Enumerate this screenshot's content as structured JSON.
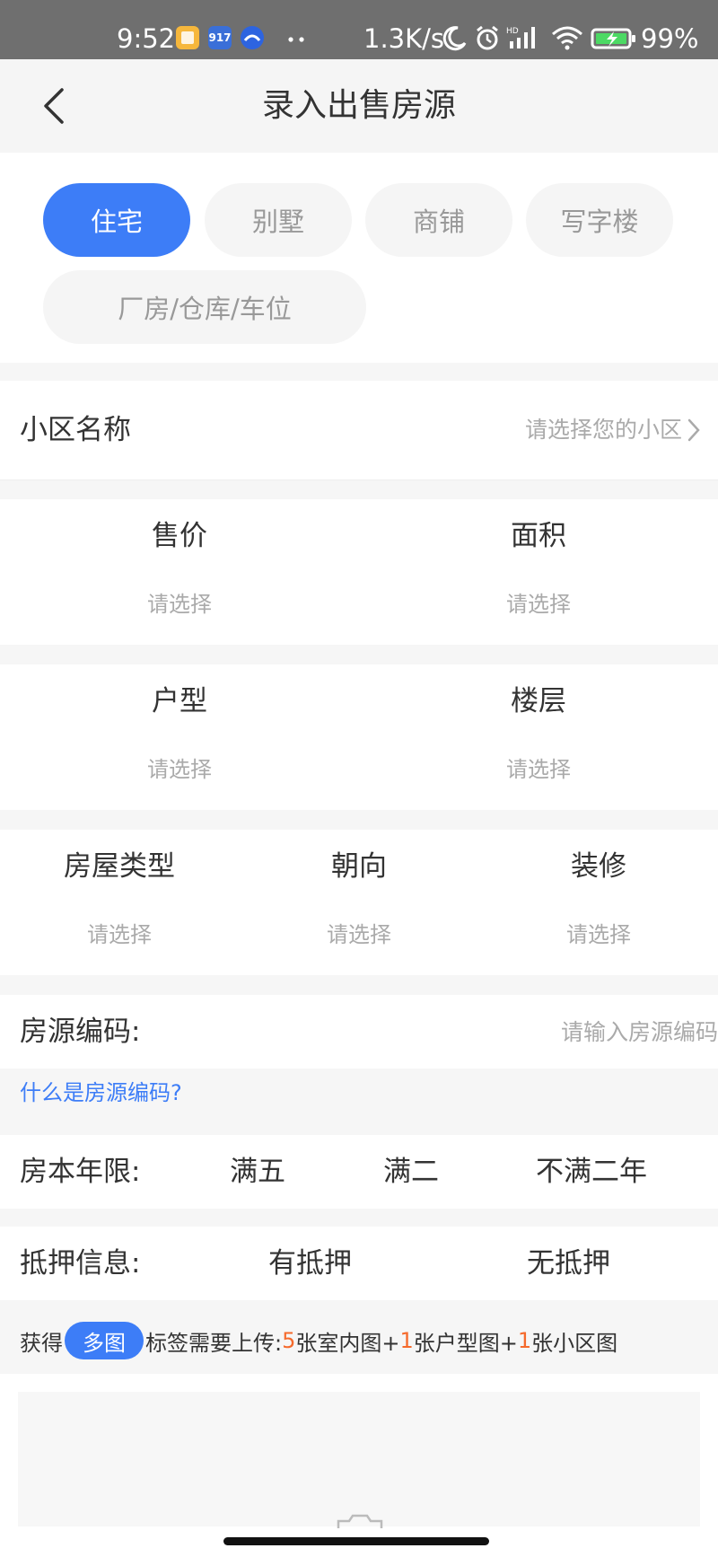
{
  "status_bar": {
    "time": "9:52",
    "app_badge_text": "917",
    "speed": "1.3K/s",
    "network": "HD",
    "battery": "99%"
  },
  "nav": {
    "back_icon": "chevron-left-icon",
    "title": "录入出售房源"
  },
  "property_types": [
    {
      "label": "住宅",
      "selected": true
    },
    {
      "label": "别墅",
      "selected": false
    },
    {
      "label": "商铺",
      "selected": false
    },
    {
      "label": "写字楼",
      "selected": false
    },
    {
      "label": "厂房/仓库/车位",
      "selected": false
    }
  ],
  "community": {
    "label": "小区名称",
    "placeholder": "请选择您的小区",
    "arrow_icon": "chevron-right-icon"
  },
  "grid_rows": [
    [
      {
        "label": "售价",
        "value": "请选择"
      },
      {
        "label": "面积",
        "value": "请选择"
      }
    ],
    [
      {
        "label": "户型",
        "value": "请选择"
      },
      {
        "label": "楼层",
        "value": "请选择"
      }
    ],
    [
      {
        "label": "房屋类型",
        "value": "请选择"
      },
      {
        "label": "朝向",
        "value": "请选择"
      },
      {
        "label": "装修",
        "value": "请选择"
      }
    ]
  ],
  "listing_code": {
    "label": "房源编码:",
    "placeholder": "请输入房源编码",
    "help_link": "什么是房源编码?"
  },
  "ownership_years": {
    "label": "房本年限:",
    "options": [
      "满五",
      "满二",
      "不满二年"
    ]
  },
  "mortgage": {
    "label": "抵押信息:",
    "options": [
      "有抵押",
      "无抵押"
    ]
  },
  "upload_hint": {
    "prefix": "获得",
    "badge": "多图",
    "middle": "标签需要上传:",
    "count_interior": "5",
    "text_interior": "张室内图+",
    "count_floorplan": "1",
    "text_floorplan": "张户型图+",
    "count_community": "1",
    "text_community": "张小区图"
  },
  "upload": {
    "icon": "camera-icon"
  },
  "colors": {
    "accent": "#3d7df7",
    "highlight": "#f56a2c"
  }
}
